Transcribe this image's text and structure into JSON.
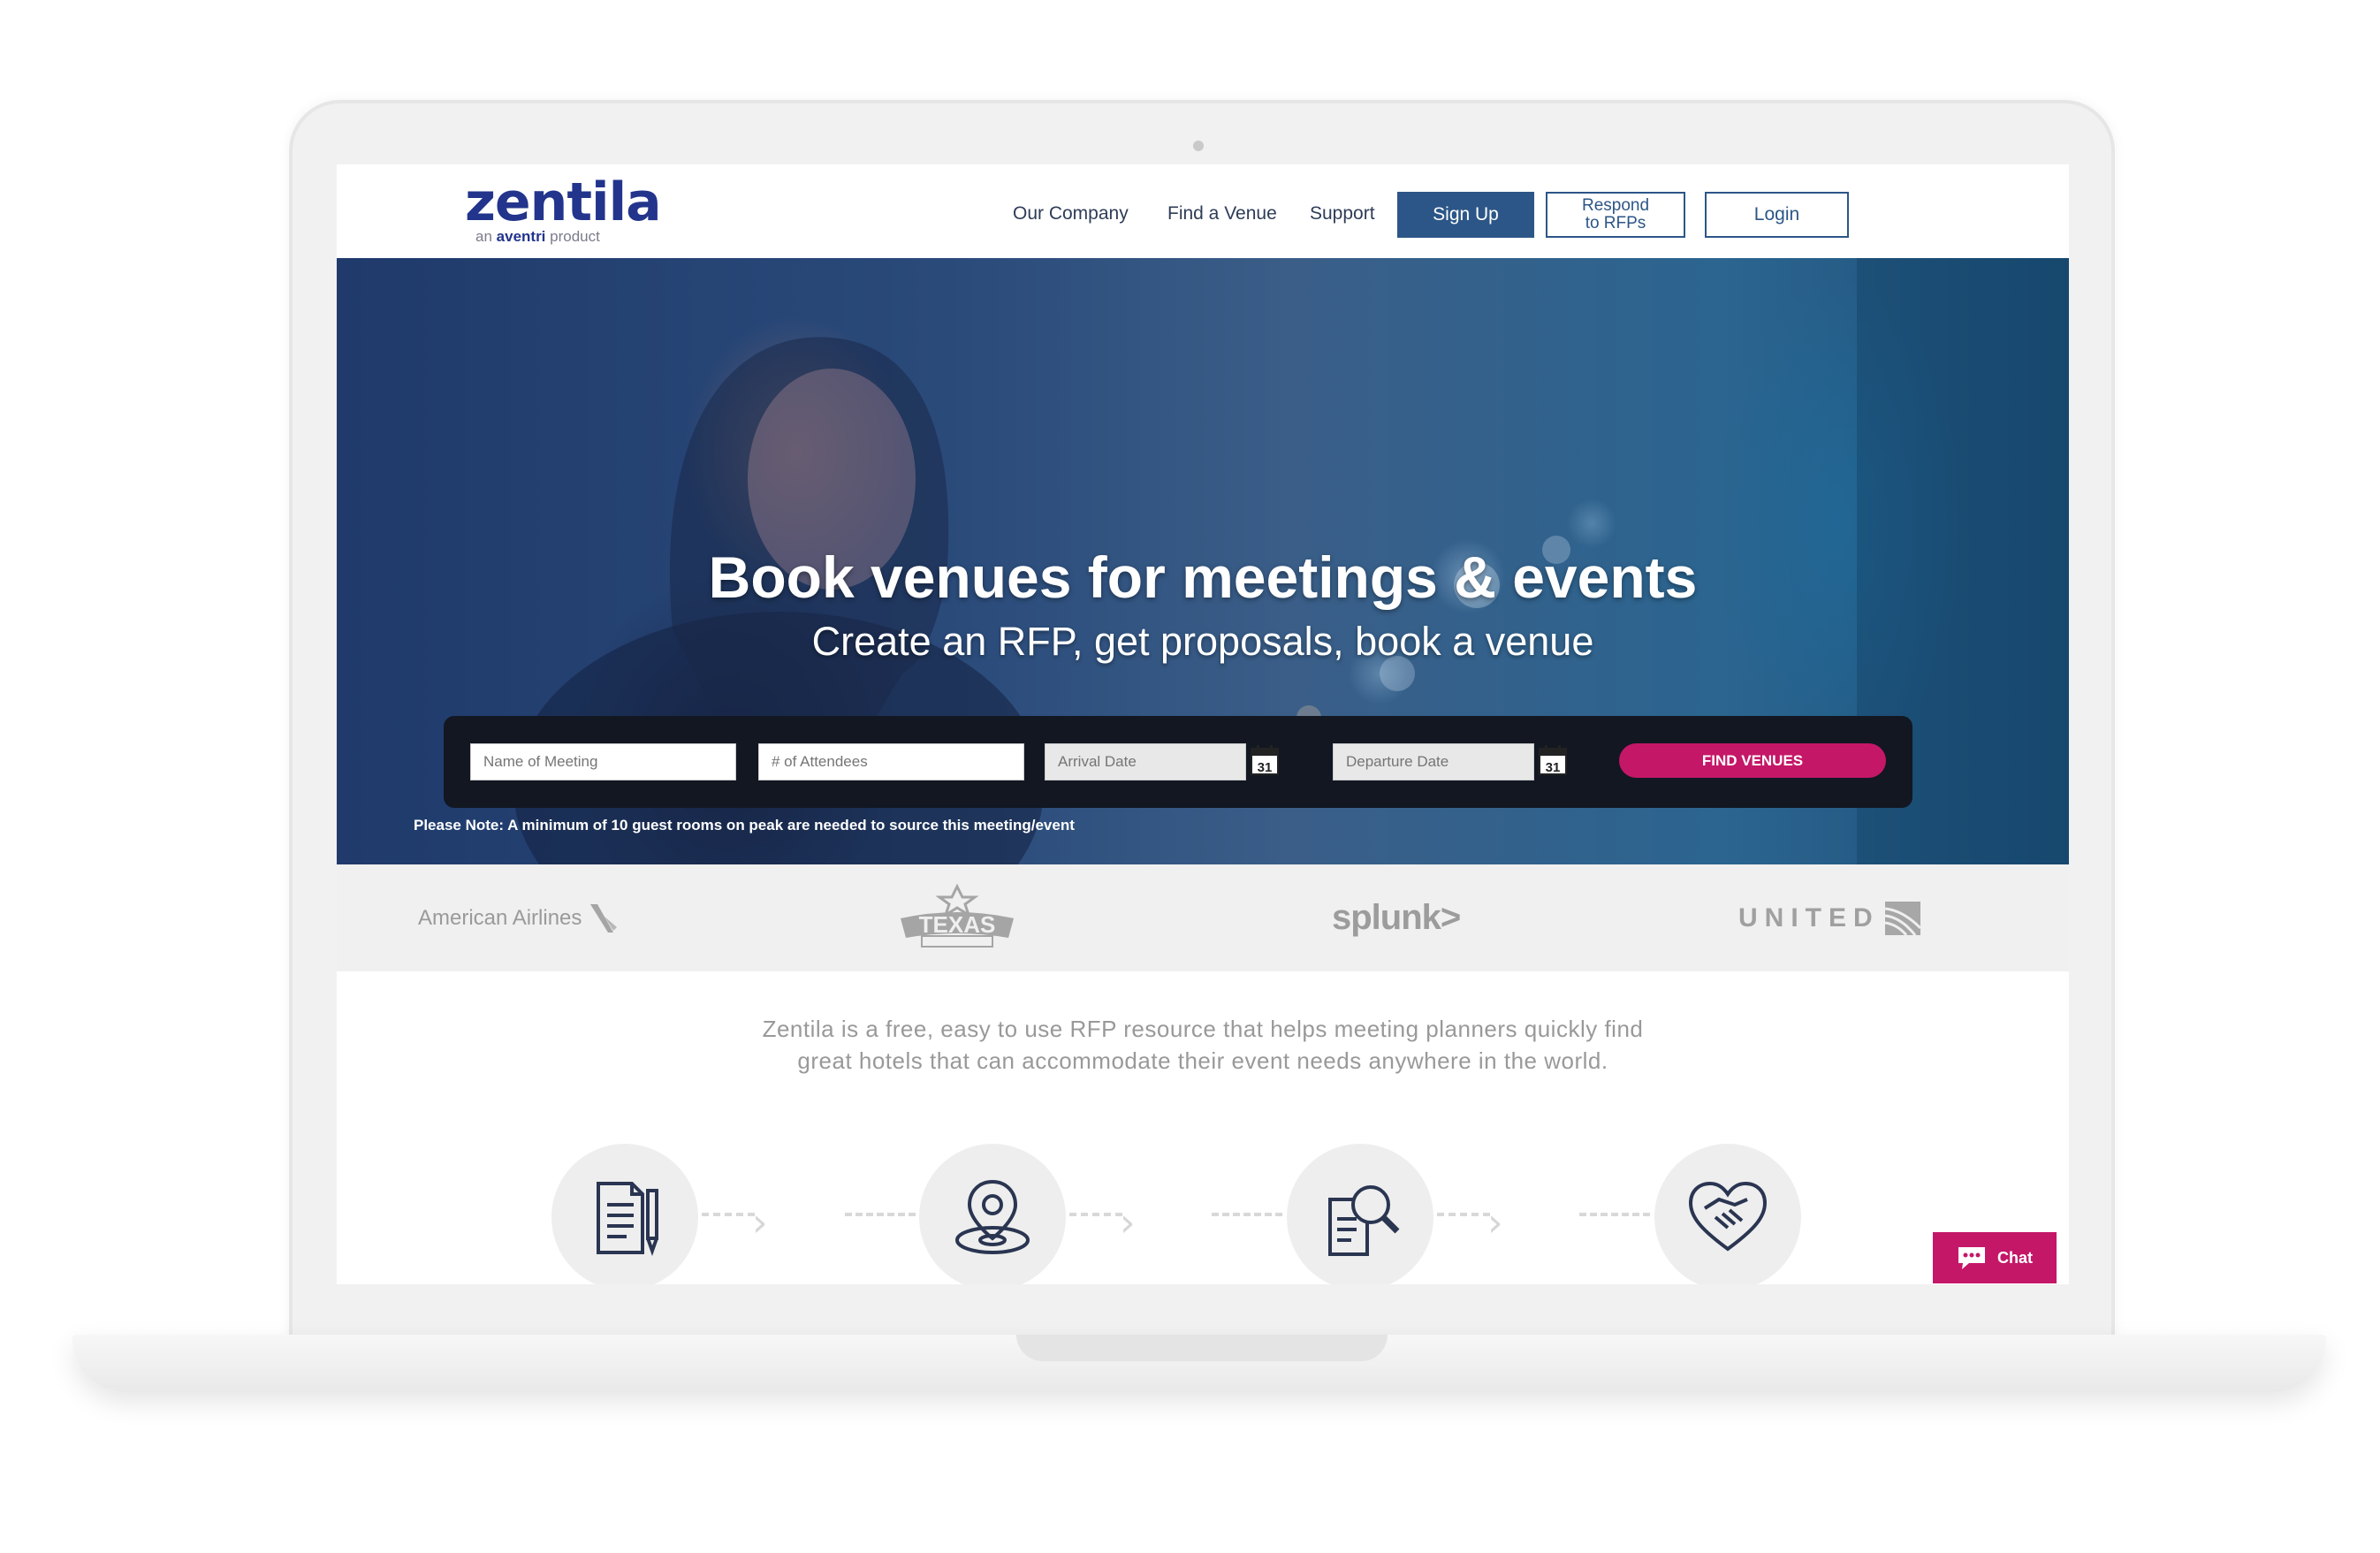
{
  "header": {
    "logo_text": "zentila",
    "logo_tag_an": "an",
    "logo_tag_brand": "aventri",
    "logo_tag_product": "product",
    "nav": [
      "Our Company",
      "Find a Venue",
      "Support"
    ],
    "signup_label": "Sign Up",
    "respond_line1": "Respond",
    "respond_line2": "to RFPs",
    "login_label": "Login"
  },
  "hero": {
    "title": "Book venues for meetings & events",
    "subtitle": "Create an RFP, get proposals, book a venue",
    "search": {
      "meeting_placeholder": "Name of Meeting",
      "attendees_placeholder": "# of Attendees",
      "arrival_placeholder": "Arrival Date",
      "departure_placeholder": "Departure Date",
      "calendar_day": "31",
      "find_label": "FIND VENUES"
    },
    "note": "Please Note: A minimum of 10 guest rooms on peak are needed to source this meeting/event"
  },
  "brands": {
    "american": "American Airlines",
    "texas": "TEXAS",
    "splunk": "splunk>",
    "united": "UNITED"
  },
  "intro": {
    "line1": "Zentila is a free, easy to use RFP resource that helps meeting planners quickly find",
    "line2": "great hotels that can accommodate their event needs anywhere in the world."
  },
  "steps": [
    "document-pen-icon",
    "location-pin-icon",
    "document-search-icon",
    "handshake-heart-icon"
  ],
  "chat": {
    "label": "Chat"
  },
  "colors": {
    "brand_navy": "#22348c",
    "button_blue": "#2c5687",
    "accent_pink": "#c41768",
    "icon_navy": "#2a3551"
  }
}
